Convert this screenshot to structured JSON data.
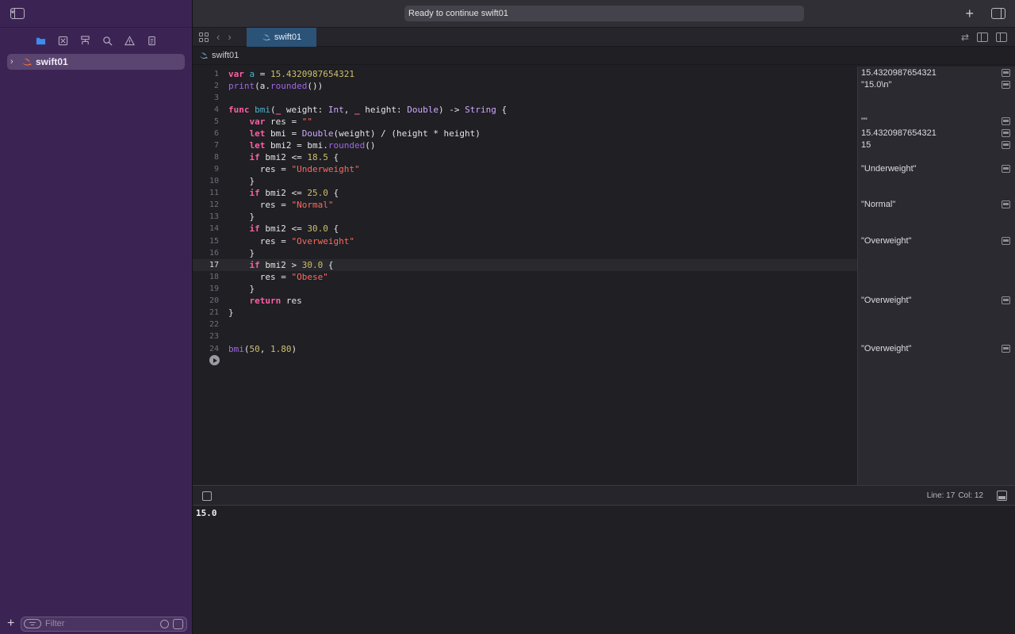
{
  "colors": {
    "sidebar_bg": "#3b2453",
    "selected_row": "#5a4470",
    "tab_active": "#2b5277",
    "keyword": "#fc5fa3",
    "string": "#fc6a5d",
    "number": "#d0bf69",
    "type": "#d0a8ff"
  },
  "sidebar": {
    "nav_icons": [
      "folder-icon",
      "source-control-icon",
      "hierarchy-icon",
      "search-icon",
      "warning-icon",
      "document-icon"
    ],
    "tree_item": "swift01",
    "filter_placeholder": "Filter"
  },
  "toolbar": {
    "status": "Ready to continue swift01"
  },
  "tabs": {
    "active": "swift01"
  },
  "breadcrumb": {
    "file": "swift01"
  },
  "editor": {
    "line_numbers": [
      "1",
      "2",
      "3",
      "4",
      "5",
      "6",
      "7",
      "8",
      "9",
      "10",
      "11",
      "12",
      "13",
      "14",
      "15",
      "16",
      "17",
      "18",
      "19",
      "20",
      "21",
      "22",
      "23",
      "24"
    ],
    "current_line": 17
  },
  "results": [
    {
      "line": 1,
      "value": "15.4320987654321"
    },
    {
      "line": 2,
      "value": "\"15.0\\n\""
    },
    {
      "line": 5,
      "value": "\"\""
    },
    {
      "line": 6,
      "value": "15.4320987654321"
    },
    {
      "line": 7,
      "value": "15"
    },
    {
      "line": 9,
      "value": "\"Underweight\""
    },
    {
      "line": 12,
      "value": "\"Normal\""
    },
    {
      "line": 15,
      "value": "\"Overweight\""
    },
    {
      "line": 20,
      "value": "\"Overweight\""
    },
    {
      "line": 24,
      "value": "\"Overweight\""
    }
  ],
  "statusbar": {
    "line_label": "Line: 17",
    "col_label": "Col: 12"
  },
  "console": {
    "output": "15.0"
  }
}
